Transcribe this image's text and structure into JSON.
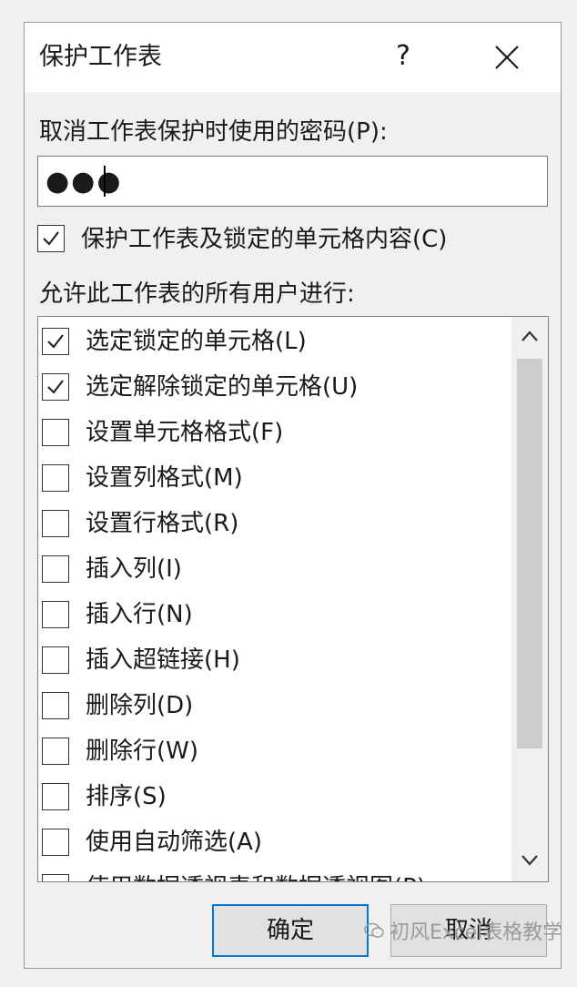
{
  "dialog": {
    "title": "保护工作表",
    "help": "?",
    "password_label": "取消工作表保护时使用的密码(P):",
    "password_value": "●●●",
    "protect_checkbox": {
      "label": "保护工作表及锁定的单元格内容(C)",
      "checked": true
    },
    "allow_label": "允许此工作表的所有用户进行:",
    "permissions": [
      {
        "label": "选定锁定的单元格(L)",
        "checked": true
      },
      {
        "label": "选定解除锁定的单元格(U)",
        "checked": true
      },
      {
        "label": "设置单元格格式(F)",
        "checked": false
      },
      {
        "label": "设置列格式(M)",
        "checked": false
      },
      {
        "label": "设置行格式(R)",
        "checked": false
      },
      {
        "label": "插入列(I)",
        "checked": false
      },
      {
        "label": "插入行(N)",
        "checked": false
      },
      {
        "label": "插入超链接(H)",
        "checked": false
      },
      {
        "label": "删除列(D)",
        "checked": false
      },
      {
        "label": "删除行(W)",
        "checked": false
      },
      {
        "label": "排序(S)",
        "checked": false
      },
      {
        "label": "使用自动筛选(A)",
        "checked": false
      },
      {
        "label": "使用数据透视表和数据透视图(P)",
        "checked": false
      }
    ],
    "ok_label": "确定",
    "cancel_label": "取消",
    "accent_color": "#0078d7"
  },
  "watermark": {
    "text": "初风Excel表格教学"
  }
}
